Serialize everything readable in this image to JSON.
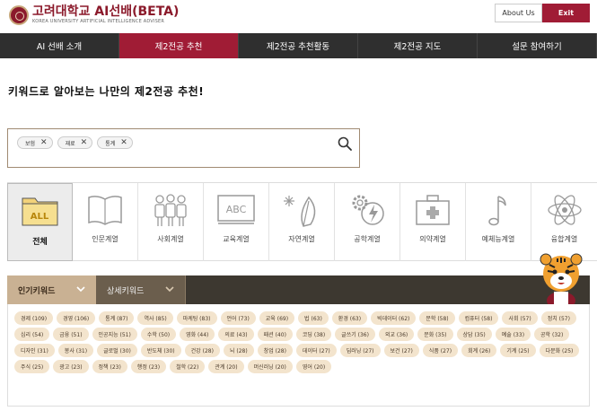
{
  "header": {
    "logo_title": "고려대학교 AI선배(BETA)",
    "logo_subtitle": "KOREA UNIVERSITY ARTIFICIAL INTELLIGENCE ADVISER",
    "about_label": "About Us",
    "exit_label": "Exit"
  },
  "nav": {
    "items": [
      {
        "label": "AI 선배 소개"
      },
      {
        "label": "제2전공 추천"
      },
      {
        "label": "제2전공 추천활동"
      },
      {
        "label": "제2전공 지도"
      },
      {
        "label": "설문 참여하기"
      }
    ],
    "active_index": 1
  },
  "page_title": "키워드로 알아보는 나만의 제2전공 추천!",
  "search": {
    "tags": [
      {
        "label": "보험"
      },
      {
        "label": "재료"
      },
      {
        "label": "통계"
      }
    ]
  },
  "categories": [
    {
      "label": "전체",
      "icon": "folder-all-icon",
      "badge": "ALL"
    },
    {
      "label": "인문계열",
      "icon": "book-icon"
    },
    {
      "label": "사회계열",
      "icon": "people-icon"
    },
    {
      "label": "교육계열",
      "icon": "chalkboard-icon",
      "badge": "ABC"
    },
    {
      "label": "자연계열",
      "icon": "nature-leaf-icon"
    },
    {
      "label": "공학계열",
      "icon": "gear-bolt-icon"
    },
    {
      "label": "의약계열",
      "icon": "medical-kit-icon"
    },
    {
      "label": "예체능계열",
      "icon": "music-note-icon"
    },
    {
      "label": "융합계열",
      "icon": "atom-icon"
    }
  ],
  "keyword_tabs": {
    "popular_label": "인기키워드",
    "detail_label": "상세키워드"
  },
  "keywords": [
    "경제 (109)",
    "경영 (106)",
    "통계 (87)",
    "역사 (85)",
    "마케팅 (83)",
    "언어 (73)",
    "교육 (69)",
    "법 (63)",
    "환경 (63)",
    "빅데이터 (62)",
    "문학 (58)",
    "컴퓨터 (58)",
    "사회 (57)",
    "정치 (57)",
    "심리 (54)",
    "금융 (51)",
    "인공지능 (51)",
    "수학 (50)",
    "영화 (44)",
    "의료 (43)",
    "패션 (40)",
    "코딩 (38)",
    "글쓰기 (36)",
    "외교 (36)",
    "문화 (35)",
    "상담 (35)",
    "예술 (33)",
    "공학 (32)",
    "디자인 (31)",
    "봉사 (31)",
    "글로벌 (30)",
    "반도체 (30)",
    "건강 (28)",
    "뇌 (28)",
    "창업 (28)",
    "데이터 (27)",
    "딥러닝 (27)",
    "보건 (27)",
    "식품 (27)",
    "회계 (26)",
    "기계 (25)",
    "다문화 (25)",
    "주식 (25)",
    "광고 (23)",
    "정책 (23)",
    "행정 (23)",
    "철학 (22)",
    "관계 (20)",
    "머신러닝 (20)",
    "영어 (20)"
  ],
  "colors": {
    "brand": "#a01c35",
    "nav_bg": "#2f2f2f",
    "chip_bg": "#f3e4cd",
    "popular_tab": "#c9b193"
  }
}
